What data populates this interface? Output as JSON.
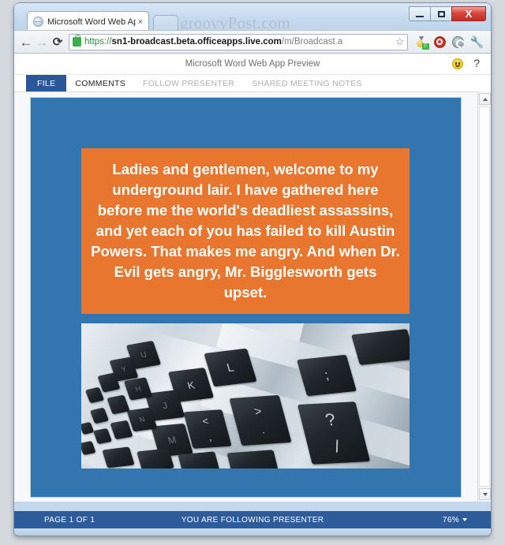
{
  "browser": {
    "watermark": "groovyPost.com",
    "tab": {
      "title": "Microsoft Word Web App",
      "close_label": "×",
      "favicon": "globe-icon"
    },
    "new_tab_label": "",
    "window_controls": {
      "minimize": "minimize-icon",
      "maximize": "maximize-icon",
      "close": "X"
    },
    "nav": {
      "back": "←",
      "forward": "→",
      "reload": "⟳",
      "url_scheme": "https://",
      "url_host": "sn1-broadcast.beta.officeapps.live.com",
      "url_path": "/m/Broadcast.a",
      "star": "☆",
      "extensions": [
        "medal-badge-icon",
        "adblock-stop-icon",
        "sync-circle-icon",
        "wrench-icon"
      ],
      "badge_count": "0"
    }
  },
  "app": {
    "title": "Microsoft Word Web App Preview",
    "smiley": "smiley-face-icon",
    "help": "?",
    "tabs": [
      {
        "label": "FILE",
        "state": "file"
      },
      {
        "label": "COMMENTS",
        "state": "active"
      },
      {
        "label": "FOLLOW PRESENTER",
        "state": "disabled"
      },
      {
        "label": "SHARED MEETING NOTES",
        "state": "disabled"
      }
    ]
  },
  "document": {
    "slide_background": "#3375af",
    "textbox_background": "#e8762f",
    "textbox_text": "Ladies and gentlemen, welcome to my underground lair. I have gathered here before me the world's deadliest assassins, and yet each of you has failed to kill Austin Powers. That makes me angry. And when Dr. Evil gets angry, Mr. Bigglesworth gets upset.",
    "image_alt": "close-up photo of laptop keyboard keys",
    "image_keys": [
      "L",
      ";",
      "?",
      "K",
      ">",
      "/",
      "M",
      "<",
      ".",
      ",",
      "J",
      "U"
    ]
  },
  "status": {
    "page": "PAGE 1 OF 1",
    "follow": "YOU ARE FOLLOWING PRESENTER",
    "zoom": "76%"
  },
  "scrollbar": {
    "up": "scroll-up-arrow",
    "down": "scroll-down-arrow"
  }
}
